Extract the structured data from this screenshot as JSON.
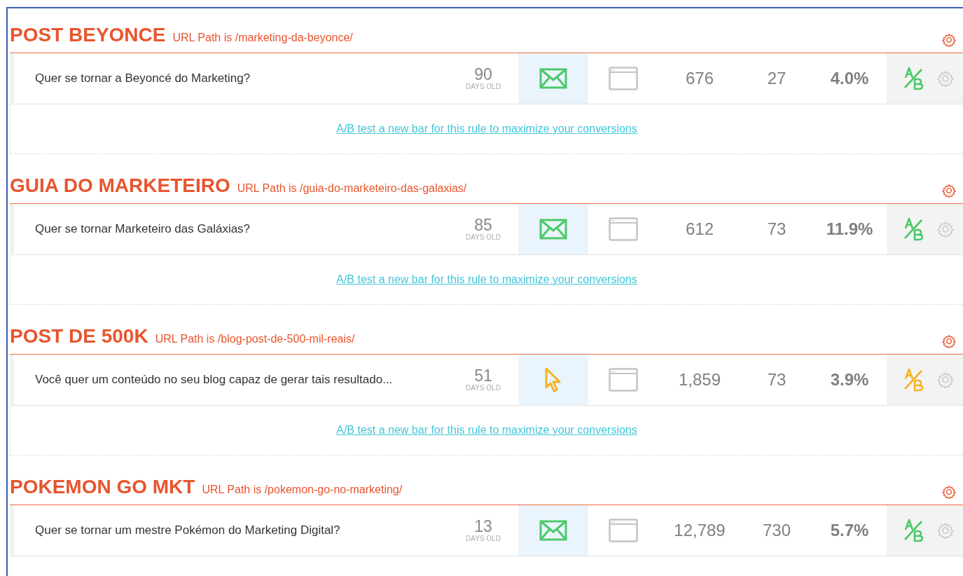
{
  "rules": [
    {
      "name": "POST BEYONCE",
      "url_path": "URL Path is /marketing-da-beyonce/",
      "headline": "Quer se tornar a Beyoncé do Marketing?",
      "days": "90",
      "days_label": "DAYS OLD",
      "goal": {
        "kind": "email"
      },
      "views": "676",
      "conversions": "27",
      "rate": "4.0%",
      "ab_link": "A/B test a new bar for this rule to maximize your conversions"
    },
    {
      "name": "GUIA DO MARKETEIRO",
      "url_path": "URL Path is /guia-do-marketeiro-das-galaxias/",
      "headline": "Quer se tornar Marketeiro das Galáxias?",
      "days": "85",
      "days_label": "DAYS OLD",
      "goal": {
        "kind": "email"
      },
      "views": "612",
      "conversions": "73",
      "rate": "11.9%",
      "ab_link": "A/B test a new bar for this rule to maximize your conversions"
    },
    {
      "name": "POST DE 500K",
      "url_path": "URL Path is /blog-post-de-500-mil-reais/",
      "headline": "Você quer um conteúdo no seu blog capaz de gerar tais resultado...",
      "days": "51",
      "days_label": "DAYS OLD",
      "goal": {
        "kind": "click"
      },
      "views": "1,859",
      "conversions": "73",
      "rate": "3.9%",
      "ab_link": "A/B test a new bar for this rule to maximize your conversions"
    },
    {
      "name": "POKEMON GO MKT",
      "url_path": "URL Path is /pokemon-go-no-marketing/",
      "headline": "Quer se tornar um mestre Pokémon do Marketing Digital?",
      "days": "13",
      "days_label": "DAYS OLD",
      "goal": {
        "kind": "email"
      },
      "views": "12,789",
      "conversions": "730",
      "rate": "5.7%"
    }
  ]
}
